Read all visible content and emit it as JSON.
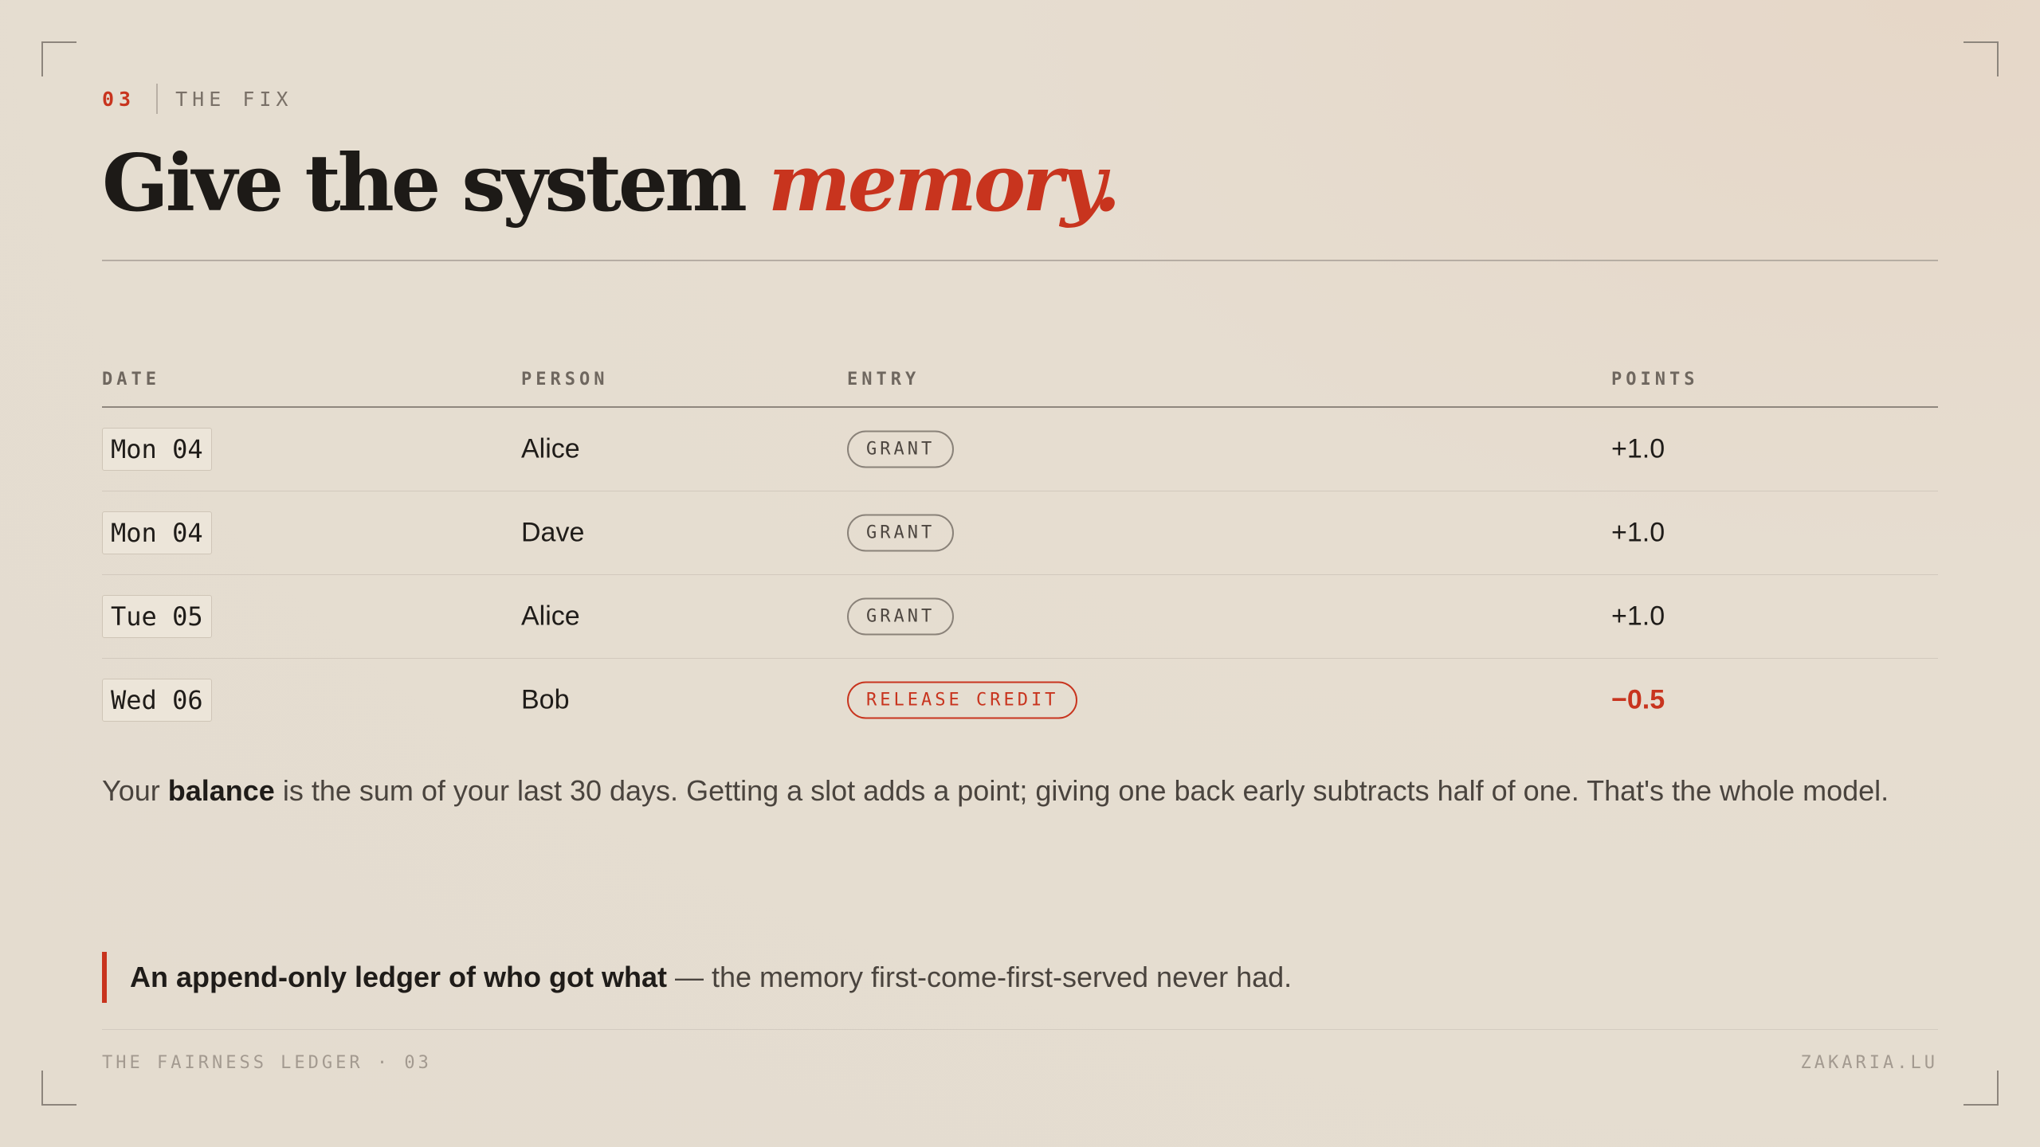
{
  "section": {
    "number": "03",
    "label": "THE FIX"
  },
  "title": {
    "main": "Give the system",
    "accent": "memory."
  },
  "ledger": {
    "columns": {
      "date": "DATE",
      "person": "PERSON",
      "entry": "ENTRY",
      "points": "POINTS"
    },
    "rows": [
      {
        "date": "Mon 04",
        "person": "Alice",
        "entry": "GRANT",
        "points": "+1.0"
      },
      {
        "date": "Mon 04",
        "person": "Dave",
        "entry": "GRANT",
        "points": "+1.0"
      },
      {
        "date": "Tue 05",
        "person": "Alice",
        "entry": "GRANT",
        "points": "+1.0"
      },
      {
        "date": "Wed 06",
        "person": "Bob",
        "entry": "RELEASE CREDIT",
        "points": "−0.5"
      }
    ]
  },
  "summary": {
    "lead": "Your ",
    "bold": "balance",
    "rest": " is the sum of your last 30 days. Getting a slot adds a point; giving one back early subtracts half of one. That's the whole model."
  },
  "callout": {
    "bold": "An append-only ledger of who got what",
    "rest": " — the memory first-come-first-served never had."
  },
  "footer": {
    "left": "THE FAIRNESS LEDGER · 03",
    "right": "ZAKARIA.LU"
  },
  "colors": {
    "accent": "#c8341e",
    "background": "#e5ddd0",
    "ink": "#1f1c19"
  }
}
